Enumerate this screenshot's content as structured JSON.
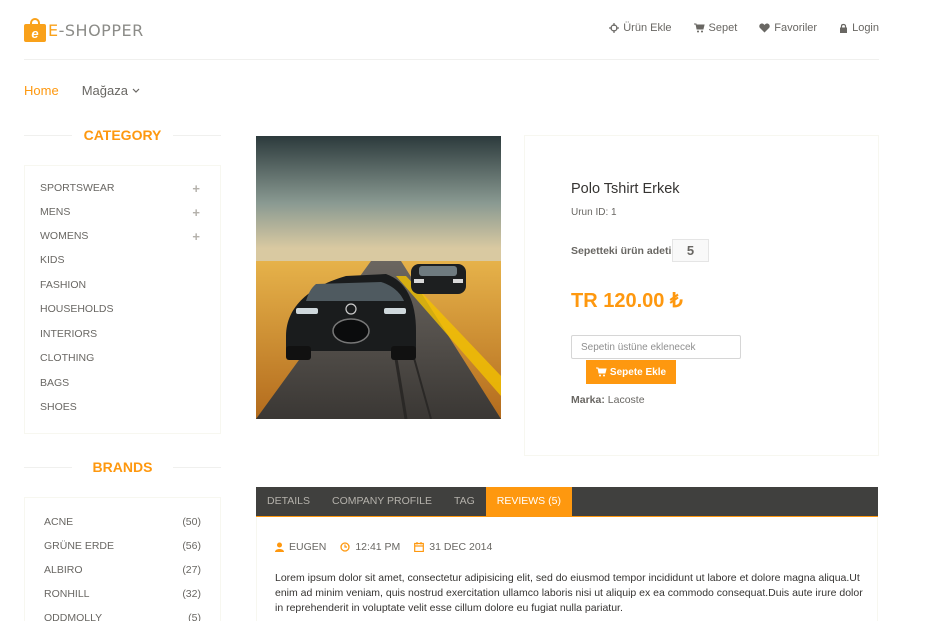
{
  "header": {
    "logo_text": "E-SHOPPER",
    "logo_letter": "e",
    "nav": [
      {
        "label": "Ürün Ekle",
        "icon": "crosshairs-icon"
      },
      {
        "label": "Sepet",
        "icon": "cart-icon"
      },
      {
        "label": "Favoriler",
        "icon": "heart-icon"
      },
      {
        "label": "Login",
        "icon": "lock-icon"
      }
    ]
  },
  "menu": {
    "home": "Home",
    "shop": "Mağaza"
  },
  "sidebar": {
    "category_title": "CATEGORY",
    "categories": [
      {
        "label": "SPORTSWEAR",
        "expand": "+"
      },
      {
        "label": "MENS",
        "expand": "+"
      },
      {
        "label": "WOMENS",
        "expand": "+"
      },
      {
        "label": "KIDS"
      },
      {
        "label": "FASHION"
      },
      {
        "label": "HOUSEHOLDS"
      },
      {
        "label": "INTERIORS"
      },
      {
        "label": "CLOTHING"
      },
      {
        "label": "BAGS"
      },
      {
        "label": "SHOES"
      }
    ],
    "brands_title": "BRANDS",
    "brands": [
      {
        "label": "ACNE",
        "count": "(50)"
      },
      {
        "label": "GRÜNE ERDE",
        "count": "(56)"
      },
      {
        "label": "ALBIRO",
        "count": "(27)"
      },
      {
        "label": "RONHILL",
        "count": "(32)"
      },
      {
        "label": "ODDMOLLY",
        "count": "(5)"
      }
    ]
  },
  "product": {
    "name": "Polo Tshirt Erkek",
    "id_text": "Urun ID: 1",
    "qty_label": "Sepetteki ürün adeti:",
    "qty_value": "5",
    "price": "TR 120.00 ₺",
    "add_placeholder": "Sepetin üstüne eklenecek",
    "add_button": "Sepete Ekle",
    "brand_label": "Marka:",
    "brand_value": "Lacoste"
  },
  "tabs": {
    "items": [
      "DETAILS",
      "COMPANY PROFILE",
      "TAG",
      "REVIEWS (5)"
    ],
    "active": "REVIEWS (5)"
  },
  "review": {
    "author": "EUGEN",
    "time": "12:41 PM",
    "date": "31 DEC 2014",
    "text": "Lorem ipsum dolor sit amet, consectetur adipisicing elit, sed do eiusmod tempor incididunt ut labore et dolore magna aliqua.Ut enim ad minim veniam, quis nostrud exercitation ullamco laboris nisi ut aliquip ex ea commodo consequat.Duis aute irure dolor in reprehenderit in voluptate velit esse cillum dolore eu fugiat nulla pariatur."
  },
  "colors": {
    "accent": "#fe980f",
    "tab_bar": "#40403e",
    "text": "#696763",
    "heading": "#363432"
  }
}
